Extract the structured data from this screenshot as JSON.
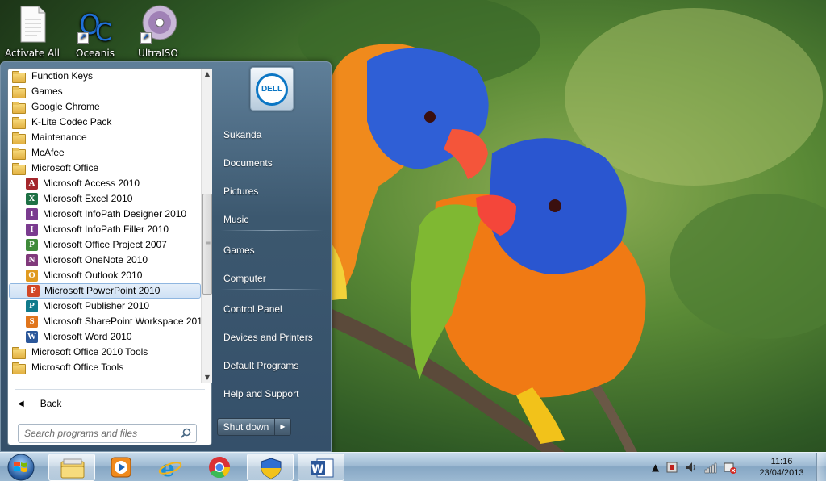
{
  "desktop": {
    "icons": [
      {
        "label": "Activate All",
        "icon": "text-file-icon"
      },
      {
        "label": "Oceanis",
        "icon": "oceanis-icon"
      },
      {
        "label": "UltraISO",
        "icon": "disc-icon"
      }
    ]
  },
  "start_menu": {
    "programs": [
      {
        "label": "Function Keys",
        "kind": "folder"
      },
      {
        "label": "Games",
        "kind": "folder"
      },
      {
        "label": "Google Chrome",
        "kind": "folder"
      },
      {
        "label": "K-Lite Codec Pack",
        "kind": "folder"
      },
      {
        "label": "Maintenance",
        "kind": "folder"
      },
      {
        "label": "McAfee",
        "kind": "folder"
      },
      {
        "label": "Microsoft Office",
        "kind": "folder"
      },
      {
        "label": "Microsoft Access 2010",
        "kind": "app",
        "glyph": "A",
        "color": "#a4262c"
      },
      {
        "label": "Microsoft Excel 2010",
        "kind": "app",
        "glyph": "X",
        "color": "#1e7145"
      },
      {
        "label": "Microsoft InfoPath Designer 2010",
        "kind": "app",
        "glyph": "I",
        "color": "#7a3b8f"
      },
      {
        "label": "Microsoft InfoPath Filler 2010",
        "kind": "app",
        "glyph": "I",
        "color": "#7a3b8f"
      },
      {
        "label": "Microsoft Office Project 2007",
        "kind": "app",
        "glyph": "P",
        "color": "#3f8a3a"
      },
      {
        "label": "Microsoft OneNote 2010",
        "kind": "app",
        "glyph": "N",
        "color": "#80397b"
      },
      {
        "label": "Microsoft Outlook 2010",
        "kind": "app",
        "glyph": "O",
        "color": "#e09a20"
      },
      {
        "label": "Microsoft PowerPoint 2010",
        "kind": "app",
        "glyph": "P",
        "color": "#d24726",
        "highlighted": true
      },
      {
        "label": "Microsoft Publisher 2010",
        "kind": "app",
        "glyph": "P",
        "color": "#117a8b"
      },
      {
        "label": "Microsoft SharePoint Workspace 201",
        "kind": "app",
        "glyph": "S",
        "color": "#e0751c"
      },
      {
        "label": "Microsoft Word 2010",
        "kind": "app",
        "glyph": "W",
        "color": "#2b579a"
      },
      {
        "label": "Microsoft Office 2010 Tools",
        "kind": "folder"
      },
      {
        "label": "Microsoft Office Tools",
        "kind": "folder"
      }
    ],
    "back_label": "Back",
    "search_placeholder": "Search programs and files",
    "user_picture": "DELL",
    "places": [
      {
        "label": "Sukanda",
        "group": 1
      },
      {
        "label": "Documents",
        "group": 1
      },
      {
        "label": "Pictures",
        "group": 1
      },
      {
        "label": "Music",
        "group": 1
      },
      {
        "label": "Games",
        "group": 2
      },
      {
        "label": "Computer",
        "group": 2
      },
      {
        "label": "Control Panel",
        "group": 3
      },
      {
        "label": "Devices and Printers",
        "group": 3
      },
      {
        "label": "Default Programs",
        "group": 3
      },
      {
        "label": "Help and Support",
        "group": 3
      }
    ],
    "shutdown_label": "Shut down"
  },
  "taskbar": {
    "pinned": [
      {
        "name": "explorer-icon",
        "active": true
      },
      {
        "name": "media-player-icon",
        "active": false
      },
      {
        "name": "internet-explorer-icon",
        "active": false
      },
      {
        "name": "chrome-icon",
        "active": false
      },
      {
        "name": "security-shield-icon",
        "active": true
      },
      {
        "name": "word-icon",
        "active": true
      }
    ],
    "clock_time": "11:16",
    "clock_date": "23/04/2013"
  }
}
